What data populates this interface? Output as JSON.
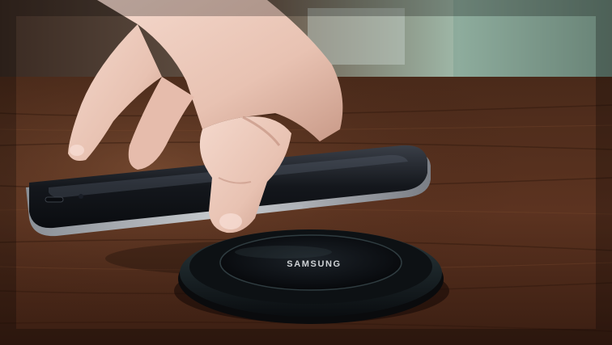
{
  "photo": {
    "pad_brand": "SAMSUNG"
  }
}
